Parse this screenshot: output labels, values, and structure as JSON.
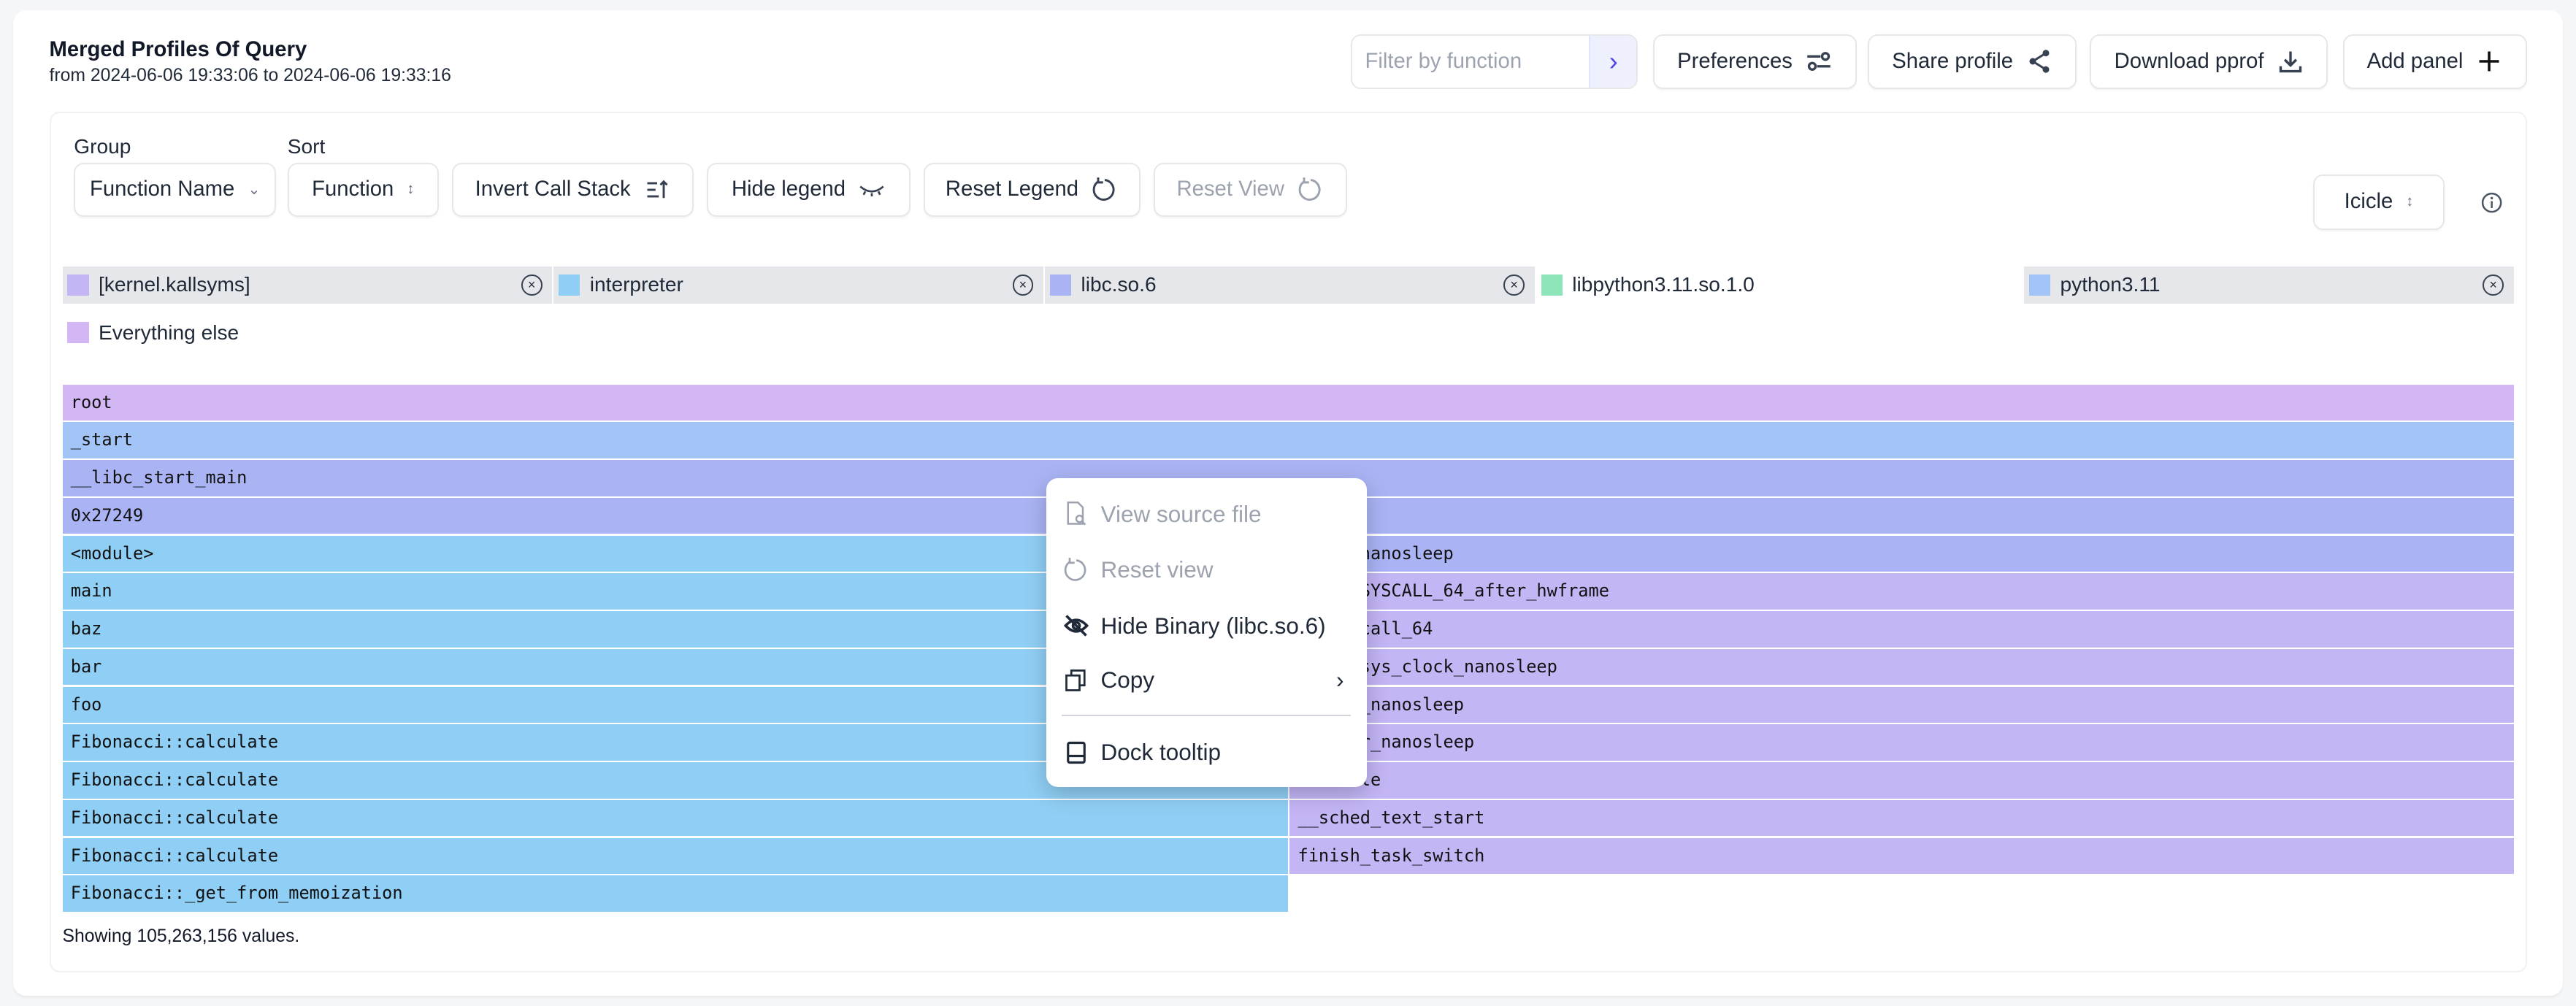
{
  "header": {
    "title": "Merged Profiles Of Query",
    "subtitle": "from 2024-06-06 19:33:06 to 2024-06-06 19:33:16"
  },
  "toolbar": {
    "filter_placeholder": "Filter by function",
    "preferences": "Preferences",
    "share": "Share profile",
    "download": "Download pprof",
    "add_panel": "Add panel"
  },
  "controls": {
    "group_label": "Group",
    "sort_label": "Sort",
    "group_value": "Function Name",
    "sort_value": "Function",
    "invert": "Invert Call Stack",
    "hide_legend": "Hide legend",
    "reset_legend": "Reset Legend",
    "reset_view": "Reset View",
    "visualization": "Icicle"
  },
  "legend": [
    {
      "label": "[kernel.kallsyms]",
      "color": "#c4b5f5",
      "removable": true
    },
    {
      "label": "interpreter",
      "color": "#90cff5",
      "removable": true
    },
    {
      "label": "libc.so.6",
      "color": "#aab4f5",
      "removable": true
    },
    {
      "label": "libpython3.11.so.1.0",
      "color": "#8de5b9",
      "removable": false
    },
    {
      "label": "python3.11",
      "color": "#a3c4f7",
      "removable": true
    },
    {
      "label": "Everything else",
      "color": "#d3b7f5",
      "removable": false
    }
  ],
  "flamegraph": {
    "rows": [
      [
        {
          "name": "root",
          "binary": 5,
          "span": "full"
        }
      ],
      [
        {
          "name": "_start",
          "binary": 4,
          "span": "full"
        }
      ],
      [
        {
          "name": "__libc_start_main",
          "binary": 2,
          "span": "full"
        }
      ],
      [
        {
          "name": "0x27249",
          "binary": 2,
          "span": "full"
        }
      ],
      [
        {
          "name": "<module>",
          "binary": 1,
          "span": "left"
        },
        {
          "name": "clock_nanosleep",
          "binary": 2,
          "span": "right"
        }
      ],
      [
        {
          "name": "main",
          "binary": 1,
          "span": "left"
        },
        {
          "name": "entry_SYSCALL_64_after_hwframe",
          "binary": 0,
          "span": "right"
        }
      ],
      [
        {
          "name": "baz",
          "binary": 1,
          "span": "left"
        },
        {
          "name": "do_syscall_64",
          "binary": 0,
          "span": "right"
        }
      ],
      [
        {
          "name": "bar",
          "binary": 1,
          "span": "left"
        },
        {
          "name": "__x64_sys_clock_nanosleep",
          "binary": 0,
          "span": "right"
        }
      ],
      [
        {
          "name": "foo",
          "binary": 1,
          "span": "left"
        },
        {
          "name": "common_nanosleep",
          "binary": 0,
          "span": "right"
        }
      ],
      [
        {
          "name": "Fibonacci::calculate",
          "binary": 1,
          "span": "left"
        },
        {
          "name": "hrtimer_nanosleep",
          "binary": 0,
          "span": "right"
        }
      ],
      [
        {
          "name": "Fibonacci::calculate",
          "binary": 1,
          "span": "left"
        },
        {
          "name": "schedule",
          "binary": 0,
          "span": "right"
        }
      ],
      [
        {
          "name": "Fibonacci::calculate",
          "binary": 1,
          "span": "left"
        },
        {
          "name": "__sched_text_start",
          "binary": 0,
          "span": "right"
        }
      ],
      [
        {
          "name": "Fibonacci::calculate",
          "binary": 1,
          "span": "left"
        },
        {
          "name": "finish_task_switch",
          "binary": 0,
          "span": "right"
        }
      ],
      [
        {
          "name": "Fibonacci::_get_from_memoization",
          "binary": 1,
          "span": "left"
        }
      ]
    ],
    "footer": "Showing 105,263,156 values."
  },
  "context_menu": {
    "items": [
      {
        "label": "View source file",
        "icon": "file-search-icon",
        "disabled": true
      },
      {
        "label": "Reset view",
        "icon": "reset-icon",
        "disabled": true
      },
      {
        "label": "Hide Binary (libc.so.6)",
        "icon": "eye-off-icon",
        "disabled": false
      },
      {
        "label": "Copy",
        "icon": "copy-icon",
        "disabled": false,
        "submenu": true
      },
      {
        "label": "Dock tooltip",
        "icon": "dock-icon",
        "disabled": false
      }
    ]
  }
}
